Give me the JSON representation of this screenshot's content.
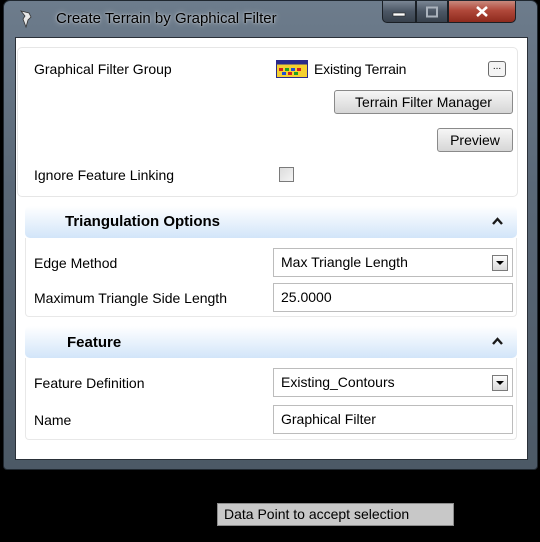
{
  "window": {
    "title": "Create Terrain by Graphical Filter",
    "icon": "civil-app-icon",
    "caption_buttons": [
      "minimize",
      "maximize",
      "close"
    ]
  },
  "filter_group": {
    "label": "Graphical Filter Group",
    "value": "Existing Terrain",
    "icon": "terrain-filter-icon",
    "browse_label": "...",
    "manager_button": "Terrain Filter Manager",
    "preview_button": "Preview"
  },
  "ignore_feature_linking": {
    "label": "Ignore Feature Linking",
    "checked": false
  },
  "triangulation": {
    "title": "Triangulation Options",
    "edge_method_label": "Edge Method",
    "edge_method_value": "Max Triangle Length",
    "max_side_label": "Maximum Triangle Side Length",
    "max_side_value": "25.0000"
  },
  "feature": {
    "title": "Feature",
    "definition_label": "Feature Definition",
    "definition_value": "Existing_Contours",
    "name_label": "Name",
    "name_value": "Graphical Filter"
  },
  "status": {
    "prompt": "Data Point to accept selection"
  },
  "colors": {
    "accent": "#d2e5f9",
    "close_button": "#b0483a"
  }
}
